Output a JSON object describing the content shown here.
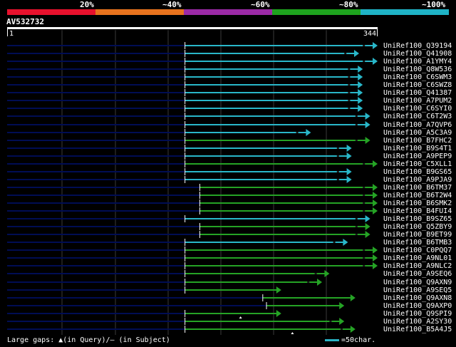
{
  "query": {
    "id": "AV532732",
    "length_start": "1",
    "length_end": "344"
  },
  "identity_legend": {
    "labels": [
      "20%",
      "~40%",
      "~60%",
      "~80%",
      "~100%"
    ],
    "colors": [
      "#e8112d",
      "#e8731e",
      "#9b2aa6",
      "#1ea31e",
      "#1fb3c6"
    ]
  },
  "colors": {
    "cyan": "#29b7c9",
    "green": "#25a325",
    "navy": "#000d54",
    "gap": "#ffffff"
  },
  "hits": [
    {
      "name": "UniRef100_Q39194",
      "color": "cyan",
      "start": 0.0,
      "end": 0.0,
      "q": [
        0.48,
        1.0
      ]
    },
    {
      "name": "UniRef100_Q41908",
      "color": "cyan",
      "q": [
        0.48,
        0.95
      ]
    },
    {
      "name": "UniRef100_A1YMY4",
      "color": "cyan",
      "q": [
        0.48,
        1.0
      ]
    },
    {
      "name": "UniRef100_Q8W536",
      "color": "cyan",
      "q": [
        0.48,
        0.96
      ]
    },
    {
      "name": "UniRef100_C6SWM3",
      "color": "cyan",
      "q": [
        0.48,
        0.96
      ]
    },
    {
      "name": "UniRef100_C6SWZ8",
      "color": "cyan",
      "q": [
        0.48,
        0.96
      ]
    },
    {
      "name": "UniRef100_Q41387",
      "color": "cyan",
      "q": [
        0.48,
        0.96
      ]
    },
    {
      "name": "UniRef100_A7PUM2",
      "color": "cyan",
      "q": [
        0.48,
        0.96
      ]
    },
    {
      "name": "UniRef100_C6SYI0",
      "color": "cyan",
      "q": [
        0.48,
        0.96
      ]
    },
    {
      "name": "UniRef100_C6T2W3",
      "color": "cyan",
      "q": [
        0.48,
        0.98
      ]
    },
    {
      "name": "UniRef100_A7QVP6",
      "color": "cyan",
      "q": [
        0.48,
        0.98
      ]
    },
    {
      "name": "UniRef100_A5C3A9",
      "color": "cyan",
      "q": [
        0.48,
        0.82
      ]
    },
    {
      "name": "UniRef100_B7FHC2",
      "color": "green",
      "q": [
        0.48,
        0.98
      ]
    },
    {
      "name": "UniRef100_B9S4T1",
      "color": "cyan",
      "q": [
        0.48,
        0.93
      ]
    },
    {
      "name": "UniRef100_A9PEP9",
      "color": "cyan",
      "q": [
        0.48,
        0.93
      ]
    },
    {
      "name": "UniRef100_C5XLL1",
      "color": "green",
      "q": [
        0.48,
        1.0
      ]
    },
    {
      "name": "UniRef100_B9GS65",
      "color": "cyan",
      "q": [
        0.48,
        0.93
      ]
    },
    {
      "name": "UniRef100_A9PJA9",
      "color": "cyan",
      "q": [
        0.48,
        0.93
      ]
    },
    {
      "name": "UniRef100_B6TM37",
      "color": "green",
      "q": [
        0.52,
        1.0
      ]
    },
    {
      "name": "UniRef100_B6T2W4",
      "color": "green",
      "q": [
        0.52,
        1.0
      ]
    },
    {
      "name": "UniRef100_B6SMK2",
      "color": "green",
      "q": [
        0.52,
        1.0
      ]
    },
    {
      "name": "UniRef100_B4FUI4",
      "color": "green",
      "q": [
        0.52,
        1.0
      ]
    },
    {
      "name": "UniRef100_B9SZ65",
      "color": "cyan",
      "q": [
        0.48,
        0.98
      ]
    },
    {
      "name": "UniRef100_Q5ZBY9",
      "color": "green",
      "q": [
        0.52,
        0.98
      ]
    },
    {
      "name": "UniRef100_B9ET99",
      "color": "green",
      "q": [
        0.52,
        0.98
      ]
    },
    {
      "name": "UniRef100_B6TMB3",
      "color": "cyan",
      "q": [
        0.48,
        0.92
      ]
    },
    {
      "name": "UniRef100_C0PQQ7",
      "color": "green",
      "q": [
        0.48,
        1.0
      ]
    },
    {
      "name": "UniRef100_A9NL01",
      "color": "green",
      "q": [
        0.48,
        1.0
      ]
    },
    {
      "name": "UniRef100_A9NLC2",
      "color": "green",
      "q": [
        0.48,
        1.0
      ]
    },
    {
      "name": "UniRef100_A9SEQ6",
      "color": "green",
      "q": [
        0.48,
        0.87
      ]
    },
    {
      "name": "UniRef100_Q9AXN9",
      "color": "green",
      "q": [
        0.48,
        0.85
      ]
    },
    {
      "name": "UniRef100_A9SEQ5",
      "color": "green",
      "q": [
        0.48,
        0.74
      ]
    },
    {
      "name": "UniRef100_Q9AXN8",
      "color": "green",
      "q": [
        0.69,
        0.94
      ]
    },
    {
      "name": "UniRef100_Q9AXP0",
      "color": "green",
      "q": [
        0.7,
        0.91
      ]
    },
    {
      "name": "UniRef100_Q9SPI9",
      "color": "green",
      "q": [
        0.48,
        0.74
      ]
    },
    {
      "name": "UniRef100_A2SY30",
      "color": "green",
      "q": [
        0.48,
        0.91
      ]
    },
    {
      "name": "UniRef100_B5A4J5",
      "color": "green",
      "q": [
        0.48,
        0.94
      ]
    }
  ],
  "footer": {
    "gaps_text": "Large gaps: ▲(in Query)/– (in Subject)",
    "scale_text": "=50char."
  }
}
